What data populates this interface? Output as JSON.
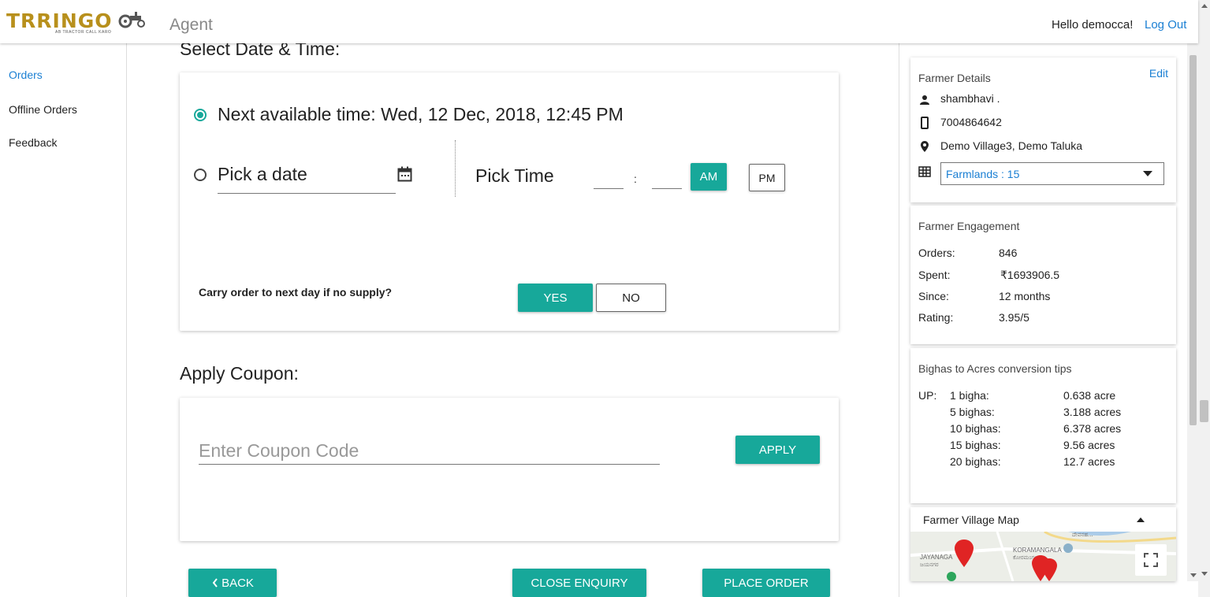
{
  "header": {
    "logo_text": "TRRINGO",
    "logo_tagline": "AB TRACTOR CALL KARO",
    "app_name": "Agent",
    "greeting": "Hello democca!",
    "logout": "Log Out"
  },
  "sidebar": {
    "items": [
      {
        "label": "Orders",
        "active": true
      },
      {
        "label": "Offline Orders",
        "active": false
      },
      {
        "label": "Feedback",
        "active": false
      }
    ]
  },
  "schedule": {
    "title": "Select Date & Time:",
    "next_available": "Next available time: Wed, 12 Dec, 2018, 12:45 PM",
    "pick_date": "Pick a date",
    "pick_time": "Pick Time",
    "time_colon": ":",
    "am": "AM",
    "pm": "PM",
    "carry_question": "Carry order to next day if no supply?",
    "yes": "YES",
    "no": "NO"
  },
  "coupon": {
    "title": "Apply Coupon:",
    "placeholder": "Enter Coupon Code",
    "apply": "APPLY"
  },
  "actions": {
    "back": "BACK",
    "close_enquiry": "CLOSE ENQUIRY",
    "place_order": "PLACE ORDER"
  },
  "farmer_details": {
    "title": "Farmer Details",
    "edit": "Edit",
    "name": "shambhavi .",
    "phone": "7004864642",
    "location": "Demo Village3, Demo Taluka",
    "farmlands": "Farmlands : 15"
  },
  "engagement": {
    "title": "Farmer Engagement",
    "rows": [
      {
        "label": "Orders:",
        "value": "846"
      },
      {
        "label": "Spent:",
        "value": "₹1693906.5"
      },
      {
        "label": "Since:",
        "value": "12 months"
      },
      {
        "label": "Rating:",
        "value": "3.95/5"
      }
    ]
  },
  "conversion": {
    "title": "Bighas to Acres conversion tips",
    "state": "UP:",
    "rows": [
      {
        "bigha": "1 bigha:",
        "acre": "0.638 acre"
      },
      {
        "bigha": "5 bighas:",
        "acre": "3.188 acres"
      },
      {
        "bigha": "10 bighas:",
        "acre": "6.378 acres"
      },
      {
        "bigha": "15 bighas:",
        "acre": "9.56 acres"
      },
      {
        "bigha": "20 bighas:",
        "acre": "12.7 acres"
      }
    ]
  },
  "map": {
    "title": "Farmer Village Map",
    "labels": {
      "jayanagar": "JAYANAGA",
      "jayanagar_kn": "ಜಯನಗರ",
      "koramangala": "KORAMANGALA",
      "koramangala_kn": "ಕೋರಮಂಗಲ",
      "top": "ದೇವನಹ..."
    }
  },
  "colors": {
    "accent": "#17a89a",
    "link": "#1a7fd3",
    "logo": "#b8901c"
  }
}
